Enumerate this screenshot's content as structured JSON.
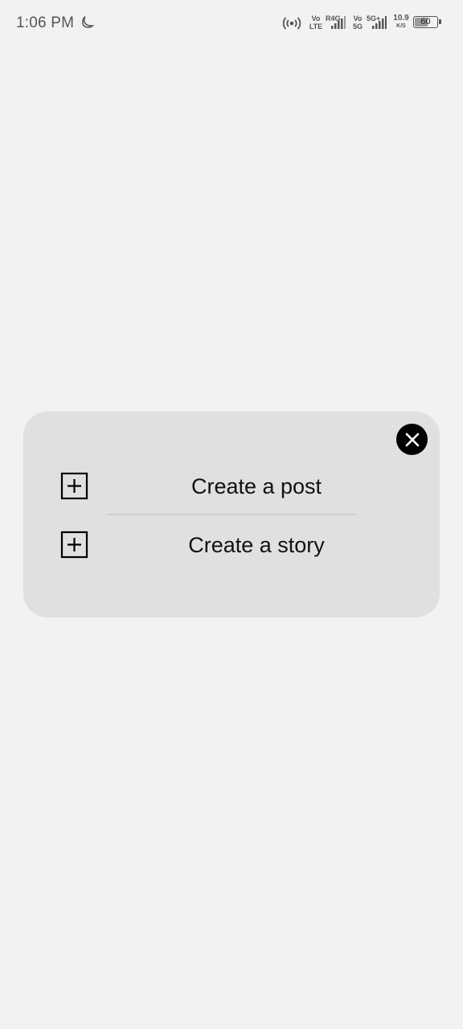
{
  "status_bar": {
    "time": "1:06 PM",
    "net1_top": "Vo",
    "net1_bottom": "LTE",
    "net2_label": "R4G",
    "net3_top": "Vo",
    "net3_bottom": "5G",
    "net4_label": "5G+",
    "speed_value": "10.9",
    "speed_unit": "K/S",
    "battery_level": "60",
    "battery_fraction": 0.6
  },
  "popup": {
    "items": [
      {
        "label": "Create a post",
        "icon": "add-square-icon"
      },
      {
        "label": "Create a story",
        "icon": "add-square-icon"
      }
    ],
    "close_icon": "close-icon"
  },
  "colors": {
    "background": "#f2f2f2",
    "card": "#e0e0e0",
    "close_button": "#000000",
    "text": "#111111"
  }
}
